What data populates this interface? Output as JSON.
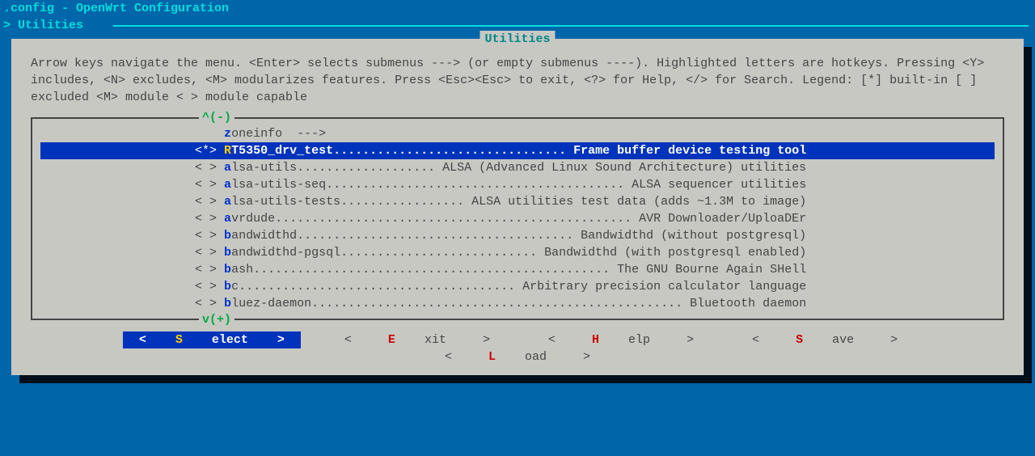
{
  "header": {
    "title": ".config - OpenWrt Configuration",
    "breadcrumb_prefix": "> ",
    "breadcrumb": "Utilities"
  },
  "box": {
    "title": "Utilities",
    "help_text": "Arrow keys navigate the menu.  <Enter> selects submenus ---> (or empty submenus ----).  Highlighted letters are hotkeys.  Pressing <Y> includes, <N> excludes, <M> modularizes features.  Press <Esc><Esc> to exit, <?> for Help, </> for Search.  Legend: [*] built-in  [ ] excluded  <M> module  < > module capable"
  },
  "scroll": {
    "top": "^(-)",
    "bottom": "v(+)"
  },
  "menu": {
    "indent": "    ",
    "items": [
      {
        "state": "   ",
        "hotkey": "z",
        "name": "oneinfo  --->",
        "desc": "",
        "selected": false,
        "submenu": true
      },
      {
        "state": "<*>",
        "hotkey": "R",
        "name": "T5350_drv_test",
        "desc": "Frame buffer device testing tool",
        "selected": true
      },
      {
        "state": "< >",
        "hotkey": "a",
        "name": "lsa-utils",
        "desc": "ALSA (Advanced Linux Sound Architecture) utilities",
        "selected": false
      },
      {
        "state": "< >",
        "hotkey": "a",
        "name": "lsa-utils-seq",
        "desc": "ALSA sequencer utilities",
        "selected": false
      },
      {
        "state": "< >",
        "hotkey": "a",
        "name": "lsa-utils-tests",
        "desc": "ALSA utilities test data (adds ~1.3M to image)",
        "selected": false
      },
      {
        "state": "< >",
        "hotkey": "a",
        "name": "vrdude",
        "desc": "AVR Downloader/UploaDEr",
        "selected": false
      },
      {
        "state": "< >",
        "hotkey": "b",
        "name": "andwidthd",
        "desc": "Bandwidthd (without postgresql)",
        "selected": false
      },
      {
        "state": "< >",
        "hotkey": "b",
        "name": "andwidthd-pgsql",
        "desc": "Bandwidthd (with postgresql enabled)",
        "selected": false
      },
      {
        "state": "< >",
        "hotkey": "b",
        "name": "ash",
        "desc": "The GNU Bourne Again SHell",
        "selected": false
      },
      {
        "state": "< >",
        "hotkey": "b",
        "name": "c",
        "desc": "Arbitrary precision calculator language",
        "selected": false
      },
      {
        "state": "< >",
        "hotkey": "b",
        "name": "luez-daemon",
        "desc": "Bluetooth daemon",
        "selected": false
      }
    ]
  },
  "buttons": {
    "items": [
      {
        "label": "Select",
        "hotkey": "S",
        "rest": "elect",
        "selected": true
      },
      {
        "label": "Exit",
        "hotkey": "E",
        "rest": "xit",
        "selected": false
      },
      {
        "label": "Help",
        "hotkey": "H",
        "rest": "elp",
        "selected": false
      },
      {
        "label": "Save",
        "hotkey": "S",
        "rest": "ave",
        "selected": false
      },
      {
        "label": "Load",
        "hotkey": "L",
        "rest": "oad",
        "selected": false
      }
    ]
  }
}
